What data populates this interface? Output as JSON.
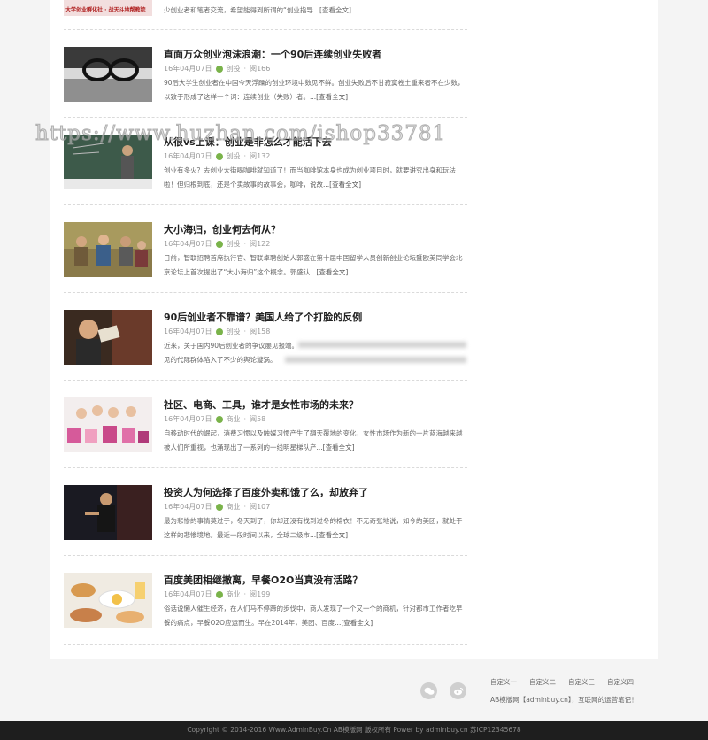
{
  "top": {
    "banner_text": "大学创业孵化社 · 战天斗地帮教院",
    "excerpt": "少创业者和笔者交流，希望能得到所谓的“创业指导...[查看全文]"
  },
  "articles": [
    {
      "title": "直面万众创业泡沫浪潮：一个90后连续创业失败者",
      "date": "16年04月07日",
      "category": "创投",
      "views": "阅166",
      "excerpt": "90后大学生创业者在中国今天浮躁的创业环境中数见不鲜。创业失败后不甘寂寞卷土重来者不在少数，以致于形成了这样一个词：连续创业（失败）者。",
      "read_more": "...[查看全文]",
      "thumb": "glasses"
    },
    {
      "title": "从很vs上课：创业是非怎么才能活下去",
      "date": "16年04月07日",
      "category": "创投",
      "views": "阅132",
      "excerpt": "创业有多火？去创业大街喝咖啡就知道了！而当咖啡馆本身也成为创业项目时，就要讲究出身和玩法啦！但归根到底，还是个卖故事的故事会，咖啡，说故",
      "read_more": "...[查看全文]",
      "thumb": "classroom"
    },
    {
      "title": "大小海归，创业何去何从？",
      "date": "16年04月07日",
      "category": "创投",
      "views": "阅122",
      "excerpt": "日前，智联招聘首席执行官、智联卓聘创始人郭盛在第十届中国留学人员创新创业论坛暨欧美同学会北京论坛上首次提出了“大小海归”这个概念。郭盛认",
      "read_more": "...[查看全文]",
      "thumb": "group"
    },
    {
      "title": "90后创业者不靠谱？美国人给了个打脸的反例",
      "date": "16年04月07日",
      "category": "创投",
      "views": "阅158",
      "excerpt": "近来，关于国内90后创业者的争议屡见报端。",
      "excerpt2": "见的代际群体陷入了不少的舆论漩涡。",
      "read_more": "",
      "thumb": "young"
    },
    {
      "title": "社区、电商、工具，谁才是女性市场的未来？",
      "date": "16年04月07日",
      "category": "商业",
      "views": "阅58",
      "excerpt": "自移动时代的崛起，消费习惯以及触媒习惯产生了翻天覆地的变化，女性市场作为新的一片蓝海越来越被人们所重视，也涌现出了一系列的一线明星梯队产",
      "read_more": "...[查看全文]",
      "thumb": "shopping"
    },
    {
      "title": "投资人为何选择了百度外卖和饿了么，却放弃了",
      "date": "16年04月07日",
      "category": "商业",
      "views": "阅107",
      "excerpt": "最为悲惨的事情莫过于，冬天到了，你却还没有找到过冬的棉衣！不无奇张地说，如今的美团，就处于这样的悲惨境地。最近一段时间以来，全球二级市",
      "read_more": "...[查看全文]",
      "thumb": "speaker"
    },
    {
      "title": "百度美团相继撤离，早餐O2O当真没有活路？",
      "date": "16年04月07日",
      "category": "商业",
      "views": "阅199",
      "excerpt": "俗话说懒人催生经济，在人们马不停蹄的步伐中，商人发现了一个又一个的商机，针对都市工作者吃早餐的痛点，早餐O2O应运而生。早在2014年，美团、百度",
      "read_more": "...[查看全文]",
      "thumb": "breakfast"
    }
  ],
  "watermark": "https://www.huzhan.com/ishop33781",
  "footer": {
    "links": [
      "自定义一",
      "自定义二",
      "自定义三",
      "自定义四"
    ],
    "site_text": "AB模版网【adminbuy.cn】，互联网的运营笔记！",
    "copyright": "Copyright © 2014-2016 Www.AdminBuy.Cn AB模版网 版权所有 Power by adminbuy.cn 苏ICP12345678"
  },
  "icons": {
    "social_1": "wechat-icon",
    "social_2": "weibo-icon",
    "meta": "category-icon"
  },
  "colors": {
    "meta_icon": "#7ab34a",
    "footer_bg": "#1e1e1e",
    "page_bg": "#f4f4f4"
  }
}
